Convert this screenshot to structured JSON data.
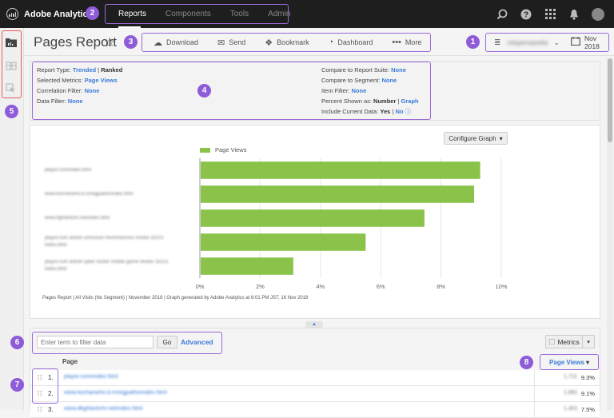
{
  "app": {
    "name": "Adobe Analytics"
  },
  "topnav": {
    "items": [
      {
        "label": "Reports",
        "active": true
      },
      {
        "label": "Components",
        "active": false
      },
      {
        "label": "Tools",
        "active": false
      },
      {
        "label": "Admin",
        "active": false
      }
    ],
    "icons": [
      "search-icon",
      "help-icon",
      "apps-grid-icon",
      "bell-icon",
      "avatar"
    ]
  },
  "badges": {
    "b1": "1",
    "b2": "2",
    "b3": "3",
    "b4": "4",
    "b5": "5",
    "b6": "6",
    "b7": "7",
    "b8": "8"
  },
  "header": {
    "title": "Pages Report",
    "actions": [
      {
        "label": "Download",
        "icon": "cloud-download-icon"
      },
      {
        "label": "Send",
        "icon": "mail-icon"
      },
      {
        "label": "Bookmark",
        "icon": "bookmark-icon"
      },
      {
        "label": "Dashboard",
        "icon": "dashboard-gauge-icon"
      },
      {
        "label": "More",
        "icon": "more-dots-icon"
      }
    ],
    "report_suite": "rsbgamepedia",
    "date": "Nov 2018"
  },
  "info": {
    "left": [
      {
        "label": "Report Type:",
        "link": "Trended",
        "sep": " | ",
        "bold": "Ranked"
      },
      {
        "label": "Selected Metrics:",
        "link": "Page Views"
      },
      {
        "label": "Correlation Filter:",
        "link": "None"
      },
      {
        "label": "Data Filter:",
        "link": "None"
      }
    ],
    "right": [
      {
        "label": "Compare to Report Suite:",
        "link": "None"
      },
      {
        "label": "Compare to Segment:",
        "link": "None"
      },
      {
        "label": "Item Filter:",
        "link": "None"
      },
      {
        "label": "Percent Shown as:",
        "bold": "Number",
        "sep": " | ",
        "link": "Graph"
      },
      {
        "label": "Include Current Data:",
        "bold": "Yes",
        "sep": " | ",
        "link": "No"
      }
    ]
  },
  "chart_controls": {
    "configure_label": "Configure Graph"
  },
  "chart_data": {
    "type": "bar",
    "orientation": "horizontal",
    "title": "",
    "legend": {
      "entries": [
        "Page Views"
      ],
      "placement": "top-left"
    },
    "categories": [
      "playor.com/index.html",
      "www.kochanwho.b.nmogpatho/index.html",
      "www.fightantchr.net/index.html",
      "playor.com article confusion freshman/xxx review 18101 index.html",
      "playor.com article cyber fucker mobile game review 18102 index.html"
    ],
    "series": [
      {
        "name": "Page Views",
        "values": [
          9.3,
          9.1,
          7.45,
          5.5,
          3.1
        ]
      }
    ],
    "xlabel": "",
    "ylabel": "",
    "xlim": [
      0,
      10
    ],
    "xticks": [
      "0%",
      "2%",
      "4%",
      "6%",
      "8%",
      "10%"
    ],
    "grid": true,
    "color": "#8bc34a",
    "footnote": "Pages Report | All Visits (No Segment) | November 2018 | Graph generated by Adobe Analytics at  6:01 PM JST, 16 Nov 2018"
  },
  "table": {
    "filter_placeholder": "Enter term to filter data",
    "go_label": "Go",
    "advanced_label": "Advanced",
    "metrics_label": "Metrics",
    "col_page": "Page",
    "col_metric": "Page Views",
    "rows": [
      {
        "rank": "1.",
        "page": "playor.com/index.html",
        "value": "1,711",
        "pct": "9.3%"
      },
      {
        "rank": "2.",
        "page": "www.kochanwho.b.nmogpatho/index.html",
        "value": "1,681",
        "pct": "9.1%"
      },
      {
        "rank": "3.",
        "page": "www.dfightantchr.net/index.html",
        "value": "1,401",
        "pct": "7.5%"
      }
    ]
  }
}
